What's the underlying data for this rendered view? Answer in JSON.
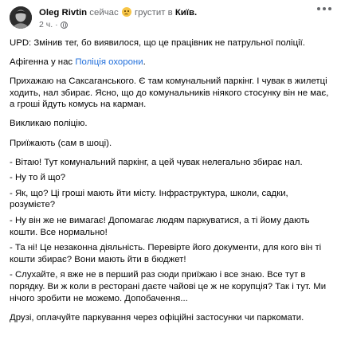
{
  "post": {
    "author": "Oleg Rivtin",
    "status_prefix": "сейчас",
    "feeling": "грустит в",
    "place": "Київ.",
    "time": "2 ч.",
    "dot": "·",
    "icons": {
      "avatar": "user-avatar",
      "privacy": "globe-icon",
      "menu": "more-options-icon",
      "emoji": "sad-face-emoji"
    },
    "paragraphs": [
      "UPD: Змінив тег, бо виявилося, що це працівник не патрульної поліції.",
      "Прихажаю на Саксаганського. Є там комунальний паркінг. І чувак в жилетці ходить, нал збирає. Ясно, що до комунальників ніякого стосунку він не має, а гроші йдуть комусь на карман.",
      "Викликаю поліцію.",
      "Приїжають (сам в шоці).",
      "- Вітаю! Тут комунальний паркінг, а цей чувак нелегально збирає нал.",
      "- Ну то й що?",
      "- Як, що? Ці гроші мають йти місту. Інфраструктура, школи, садки, розумієте?",
      "- Ну він же не вимагає! Допомагає людям паркуватися, а ті йому дають кошти. Все нормально!",
      "- Та ні! Це незаконна діяльність. Перевірте його документи, для кого він ті кошти збирає? Вони мають йти в бюджет!",
      "- Слухайте, я вже не в перший раз сюди приїжаю і все знаю. Все тут в порядку. Ви ж коли в ресторані даєте чайові це ж не корупція? Так і тут. Ми нічого зробити не можемо. Допобачення...",
      "Друзі, оплачуйте паркування через офіційні застосунки чи паркомати."
    ],
    "tag_line": {
      "prefix": "Афігенна у нас",
      "link": "Поліція охорони",
      "suffix": "."
    }
  },
  "colors": {
    "link": "#216fdb",
    "secondary_text": "#65676b",
    "text": "#050505"
  }
}
